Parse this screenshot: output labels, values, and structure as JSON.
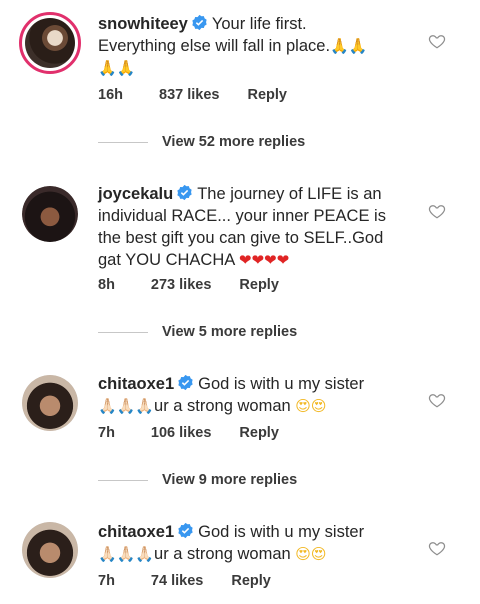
{
  "comments": [
    {
      "username": "snowhiteey",
      "text_line1": "Your life first.",
      "text_line2": "Everything else will fall in place.",
      "emoji_inline": "🙏🙏",
      "emoji_line3": "🙏🙏",
      "time": "16h",
      "likes": "837 likes",
      "reply": "Reply",
      "view_replies": "View 52 more replies"
    },
    {
      "username": "joycekalu",
      "text_line1": "The journey of LIFE is an",
      "text_line2": "individual RACE... your inner PEACE is",
      "text_line3": "the best gift you can give to SELF..God",
      "text_line4": "gat YOU CHACHA",
      "emoji_hearts": "❤❤❤❤",
      "time": "8h",
      "likes": "273 likes",
      "reply": "Reply",
      "view_replies": "View 5 more replies"
    },
    {
      "username": "chitaoxe1",
      "text_line1": "God is with u my sister",
      "emoji_pray": "🙏🏻🙏🏻🙏🏻",
      "text_line2": "ur a strong woman",
      "emoji_faces": "😍😍",
      "time": "7h",
      "likes": "106 likes",
      "reply": "Reply",
      "view_replies": "View 9 more replies"
    },
    {
      "username": "chitaoxe1",
      "text_line1": "God is with u my sister",
      "emoji_pray": "🙏🏻🙏🏻🙏🏻",
      "text_line2": "ur a strong woman",
      "emoji_faces": "😍😍",
      "time": "7h",
      "likes": "74 likes",
      "reply": "Reply"
    }
  ],
  "icons": {
    "verified": "verified-badge-icon",
    "like": "heart-outline-icon"
  },
  "colors": {
    "verified_blue": "#3897f0",
    "story_ring": "#e1306c",
    "text": "#262626",
    "meta": "#3a3a3a",
    "divider": "#c7c7c7"
  }
}
